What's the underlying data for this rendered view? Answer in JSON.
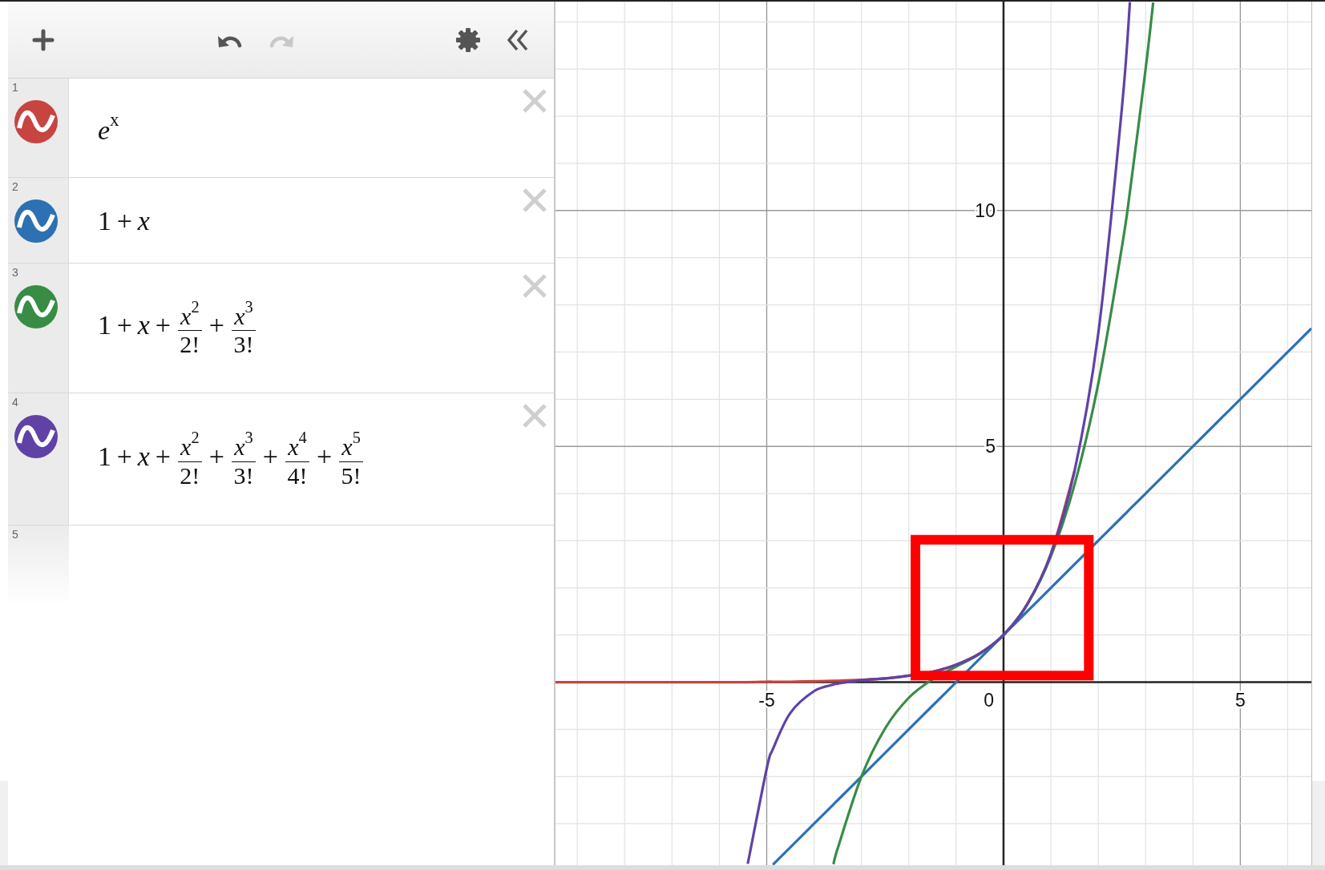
{
  "toolbar": {
    "buttons": [
      {
        "kind": "add",
        "disabled": false
      },
      {
        "kind": "undo",
        "disabled": false
      },
      {
        "kind": "redo",
        "disabled": true
      },
      {
        "kind": "settings",
        "disabled": false
      },
      {
        "kind": "collapse",
        "disabled": false
      }
    ]
  },
  "expressions": [
    {
      "number": "1",
      "kind": "expression",
      "color": "#c74440",
      "terms": [
        {
          "kind": "power",
          "base": "e",
          "exp": "x"
        }
      ]
    },
    {
      "number": "2",
      "kind": "expression",
      "color": "#2d70b3",
      "terms": [
        {
          "kind": "num",
          "text": "1"
        },
        {
          "kind": "op",
          "text": "+"
        },
        {
          "kind": "var",
          "text": "x"
        }
      ]
    },
    {
      "number": "3",
      "kind": "expression",
      "color": "#388c46",
      "terms": [
        {
          "kind": "num",
          "text": "1"
        },
        {
          "kind": "op",
          "text": "+"
        },
        {
          "kind": "var",
          "text": "x"
        },
        {
          "kind": "op",
          "text": "+"
        },
        {
          "kind": "frac",
          "base": "x",
          "exp": "2",
          "den": "2!"
        },
        {
          "kind": "op",
          "text": "+"
        },
        {
          "kind": "frac",
          "base": "x",
          "exp": "3",
          "den": "3!"
        }
      ]
    },
    {
      "number": "4",
      "kind": "expression",
      "color": "#6042a6",
      "terms": [
        {
          "kind": "num",
          "text": "1"
        },
        {
          "kind": "op",
          "text": "+"
        },
        {
          "kind": "var",
          "text": "x"
        },
        {
          "kind": "op",
          "text": "+"
        },
        {
          "kind": "frac",
          "base": "x",
          "exp": "2",
          "den": "2!"
        },
        {
          "kind": "op",
          "text": "+"
        },
        {
          "kind": "frac",
          "base": "x",
          "exp": "3",
          "den": "3!"
        },
        {
          "kind": "op",
          "text": "+"
        },
        {
          "kind": "frac",
          "base": "x",
          "exp": "4",
          "den": "4!"
        },
        {
          "kind": "op",
          "text": "+"
        },
        {
          "kind": "frac",
          "base": "x",
          "exp": "5",
          "den": "5!"
        }
      ]
    },
    {
      "number": "5",
      "kind": "empty"
    }
  ],
  "graph": {
    "origin_label": "0",
    "highlighted_region": true,
    "chart_data": {
      "type": "line",
      "xlim": [
        -9.46,
        6.5
      ],
      "ylim": [
        -3.88,
        14.43
      ],
      "xticks": [
        -5,
        5
      ],
      "yticks": [
        5,
        10
      ],
      "x": [
        -9.46,
        -8,
        -7,
        -6,
        -5.4,
        -5,
        -4.87,
        -4.5,
        -4,
        -3.59,
        -3.5,
        -3,
        -2.5,
        -2,
        -1.5,
        -1,
        -0.5,
        0,
        0.5,
        1,
        1.5,
        2,
        2.5,
        2.669,
        3,
        3.16,
        3.5,
        4,
        4.5,
        5,
        5.5,
        6,
        6.5
      ],
      "series": [
        {
          "color": "#c74440",
          "values": [
            0,
            0,
            0,
            0,
            0,
            0.01,
            0.01,
            0.01,
            0.02,
            0.03,
            0.03,
            0.05,
            0.08,
            0.14,
            0.22,
            0.37,
            0.61,
            1,
            1.65,
            2.72,
            4.48,
            null,
            null,
            null,
            null,
            null,
            null,
            null,
            null,
            null,
            null,
            null,
            null
          ]
        },
        {
          "color": "#2d70b3",
          "values": [
            null,
            null,
            null,
            null,
            null,
            null,
            -3.87,
            -3.5,
            -3,
            -2.59,
            -2.5,
            -2,
            -1.5,
            -1,
            -0.5,
            0,
            0.5,
            1,
            1.5,
            2,
            2.5,
            3,
            3.5,
            3.67,
            4,
            4.16,
            4.5,
            5,
            5.5,
            6,
            6.5,
            7,
            7.5
          ]
        },
        {
          "color": "#388c46",
          "values": [
            null,
            null,
            null,
            null,
            null,
            null,
            null,
            null,
            null,
            -3.86,
            -3.52,
            -2,
            -0.98,
            -0.33,
            0.06,
            0.33,
            0.6,
            1,
            1.65,
            2.67,
            4.19,
            6.33,
            9.23,
            10.4,
            13,
            14.41,
            null,
            null,
            null,
            null,
            null,
            null,
            null
          ]
        },
        {
          "color": "#6042a6",
          "values": [
            null,
            null,
            null,
            null,
            -3.85,
            -1.83,
            -1.42,
            -0.65,
            -0.19,
            -0.05,
            -0.03,
            0.04,
            0.08,
            0.14,
            0.22,
            0.37,
            0.61,
            1,
            1.65,
            2.72,
            4.48,
            7.39,
            12.18,
            14.42,
            null,
            null,
            null,
            null,
            null,
            null,
            null,
            null,
            null
          ]
        }
      ],
      "grid": true
    }
  }
}
